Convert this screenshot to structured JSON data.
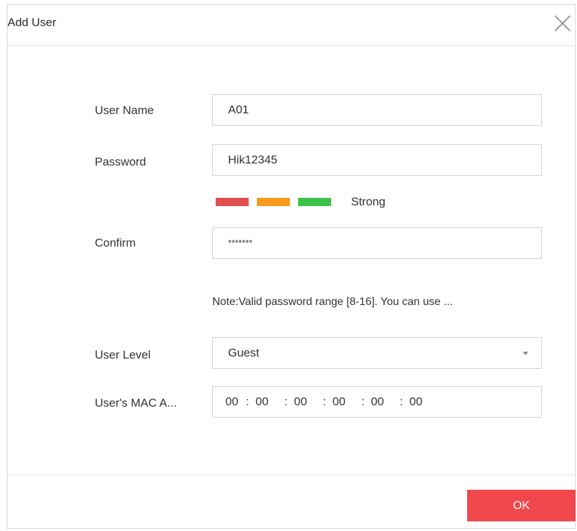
{
  "dialog": {
    "title": "Add User",
    "close_icon": "close-icon"
  },
  "form": {
    "user_name": {
      "label": "User Name",
      "value": "A01"
    },
    "password": {
      "label": "Password",
      "value": "Hik12345"
    },
    "strength": {
      "label": "Strong",
      "colors": [
        "#e04f4f",
        "#f79a1b",
        "#3cc24b"
      ]
    },
    "confirm": {
      "label": "Confirm",
      "value": "*******"
    },
    "note": "Note:Valid password range [8-16]. You can use ...",
    "user_level": {
      "label": "User Level",
      "value": "Guest",
      "icon": "chevron-down-icon"
    },
    "mac": {
      "label": "User's MAC A...",
      "segments": [
        "00",
        "00",
        "00",
        "00",
        "00",
        "00"
      ]
    }
  },
  "footer": {
    "ok_label": "OK",
    "ok_color": "#f1484d"
  }
}
